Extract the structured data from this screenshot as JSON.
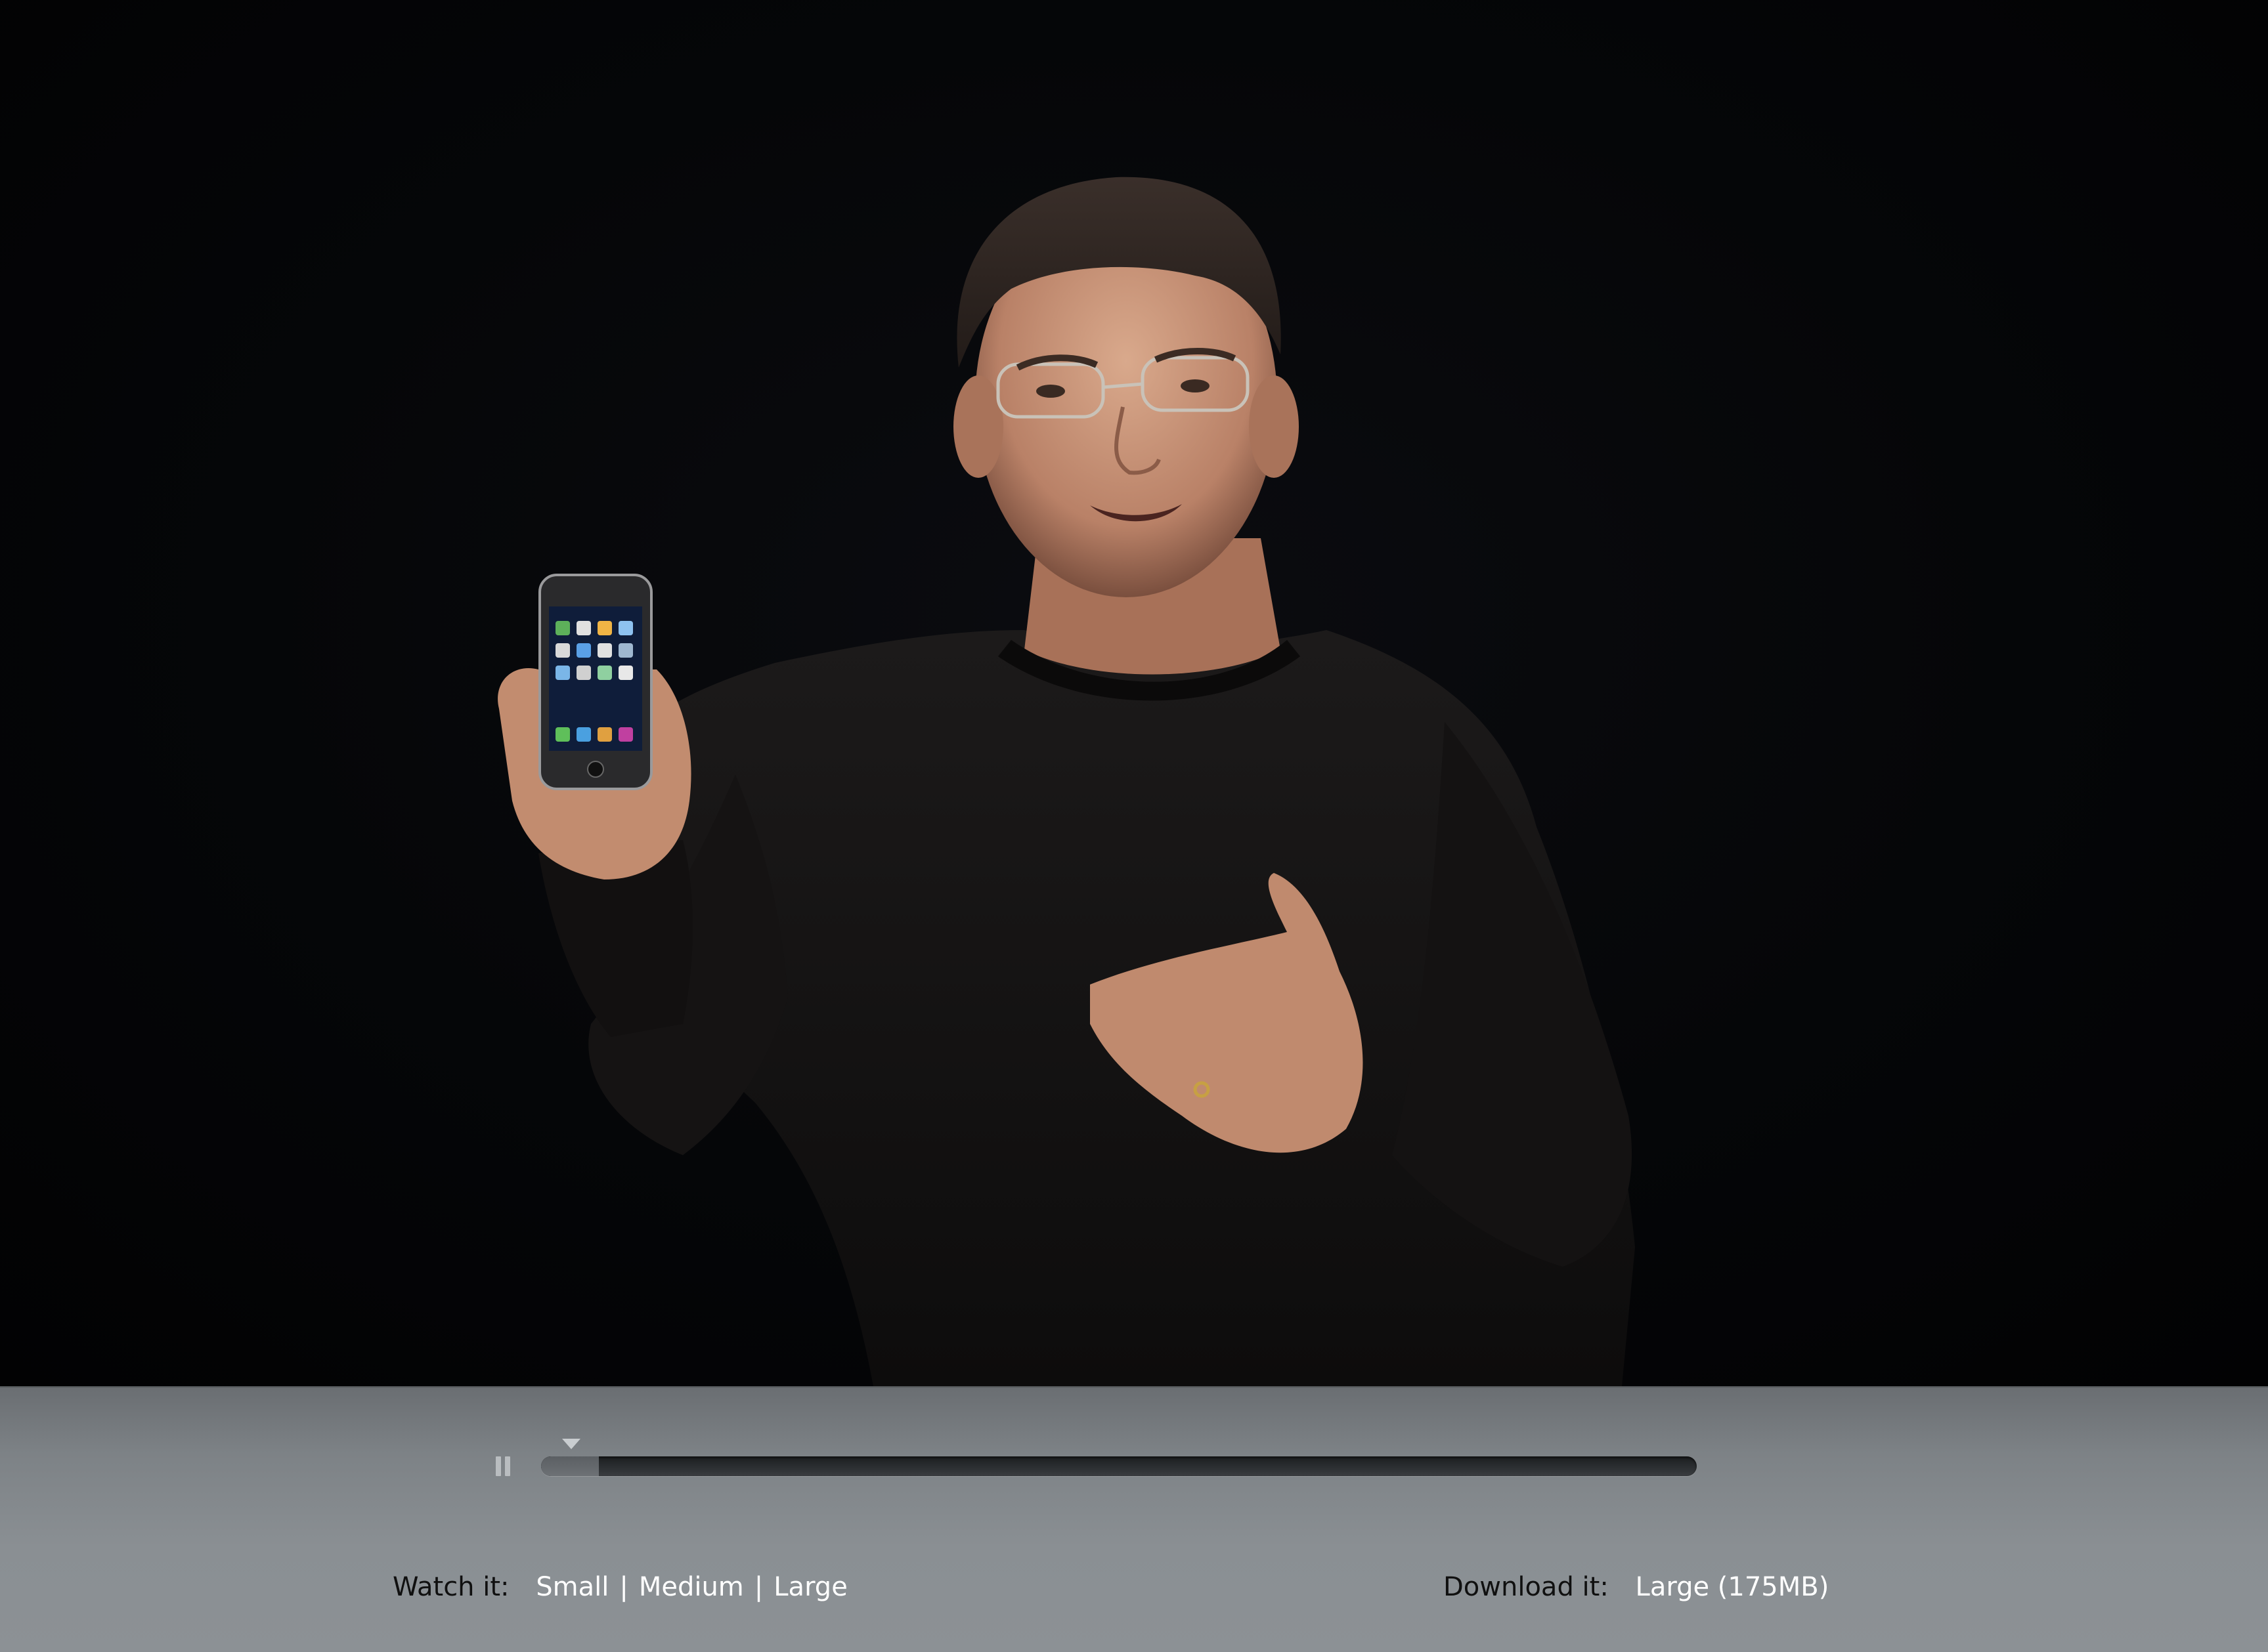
{
  "player": {
    "watch_label": "Watch it:",
    "watch_options": [
      "Small",
      "Medium",
      "Large"
    ],
    "separator": "|",
    "download_label": "Download it:",
    "download_option": "Large (175MB)",
    "progress_fraction": 0.05
  },
  "colors": {
    "video_background": "#020203",
    "control_bar": "#898e92",
    "link_text": "#ffffff",
    "label_text": "#111111"
  },
  "icons": {
    "pause": "pause-icon",
    "playhead": "playhead-triangle-icon"
  }
}
